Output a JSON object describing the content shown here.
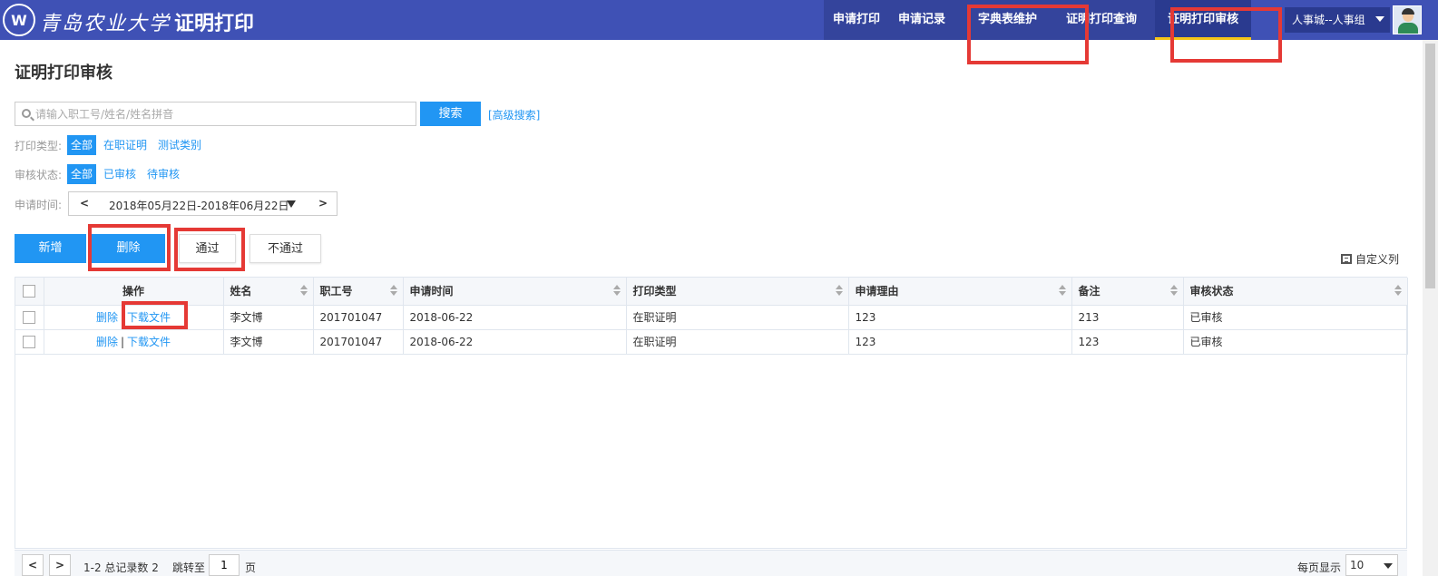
{
  "header": {
    "logo_mark": "W",
    "logo_name": "青岛农业大学",
    "title": "证明打印",
    "nav": [
      {
        "label": "申请打印"
      },
      {
        "label": "申请记录"
      },
      {
        "label": "字典表维护"
      },
      {
        "label": "证明打印查询"
      },
      {
        "label": "证明打印审核",
        "active": true
      }
    ],
    "user": "人事城--人事组"
  },
  "page": {
    "title": "证明打印审核"
  },
  "search": {
    "placeholder": "请输入职工号/姓名/姓名拼音",
    "value": "",
    "button": "搜索",
    "advanced": "[高级搜索]"
  },
  "filters": {
    "print_type": {
      "label": "打印类型:",
      "options": [
        "全部",
        "在职证明",
        "测试类别"
      ],
      "selected": "全部"
    },
    "audit_status": {
      "label": "审核状态:",
      "options": [
        "全部",
        "已审核",
        "待审核"
      ],
      "selected": "全部"
    },
    "apply_time": {
      "label": "申请时间:",
      "prev": "<",
      "range": "2018年05月22日-2018年06月22日",
      "next": ">"
    }
  },
  "actions": {
    "add": "新增",
    "delete": "删除",
    "pass": "通过",
    "reject": "不通过",
    "custom_columns": "自定义列"
  },
  "table": {
    "headers": [
      "操作",
      "姓名",
      "职工号",
      "申请时间",
      "打印类型",
      "申请理由",
      "备注",
      "审核状态"
    ],
    "op_delete": "删除",
    "op_sep": "|",
    "op_download": "下载文件",
    "rows": [
      {
        "name": "李文博",
        "emp_no": "201701047",
        "date": "2018-06-22",
        "type": "在职证明",
        "reason": "123",
        "remark": "213",
        "status": "已审核"
      },
      {
        "name": "李文博",
        "emp_no": "201701047",
        "date": "2018-06-22",
        "type": "在职证明",
        "reason": "123",
        "remark": "123",
        "status": "已审核"
      }
    ]
  },
  "pager": {
    "prev": "<",
    "next": ">",
    "info": "1-2 总记录数 2",
    "jump_label": "跳转至",
    "jump_value": "1",
    "page_unit": "页",
    "size_label": "每页显示",
    "size_value": "10"
  },
  "colors": {
    "header_bg": "#3f51b5",
    "accent": "#2196f3",
    "highlight": "#e53935",
    "active_underline": "#f5c518"
  }
}
